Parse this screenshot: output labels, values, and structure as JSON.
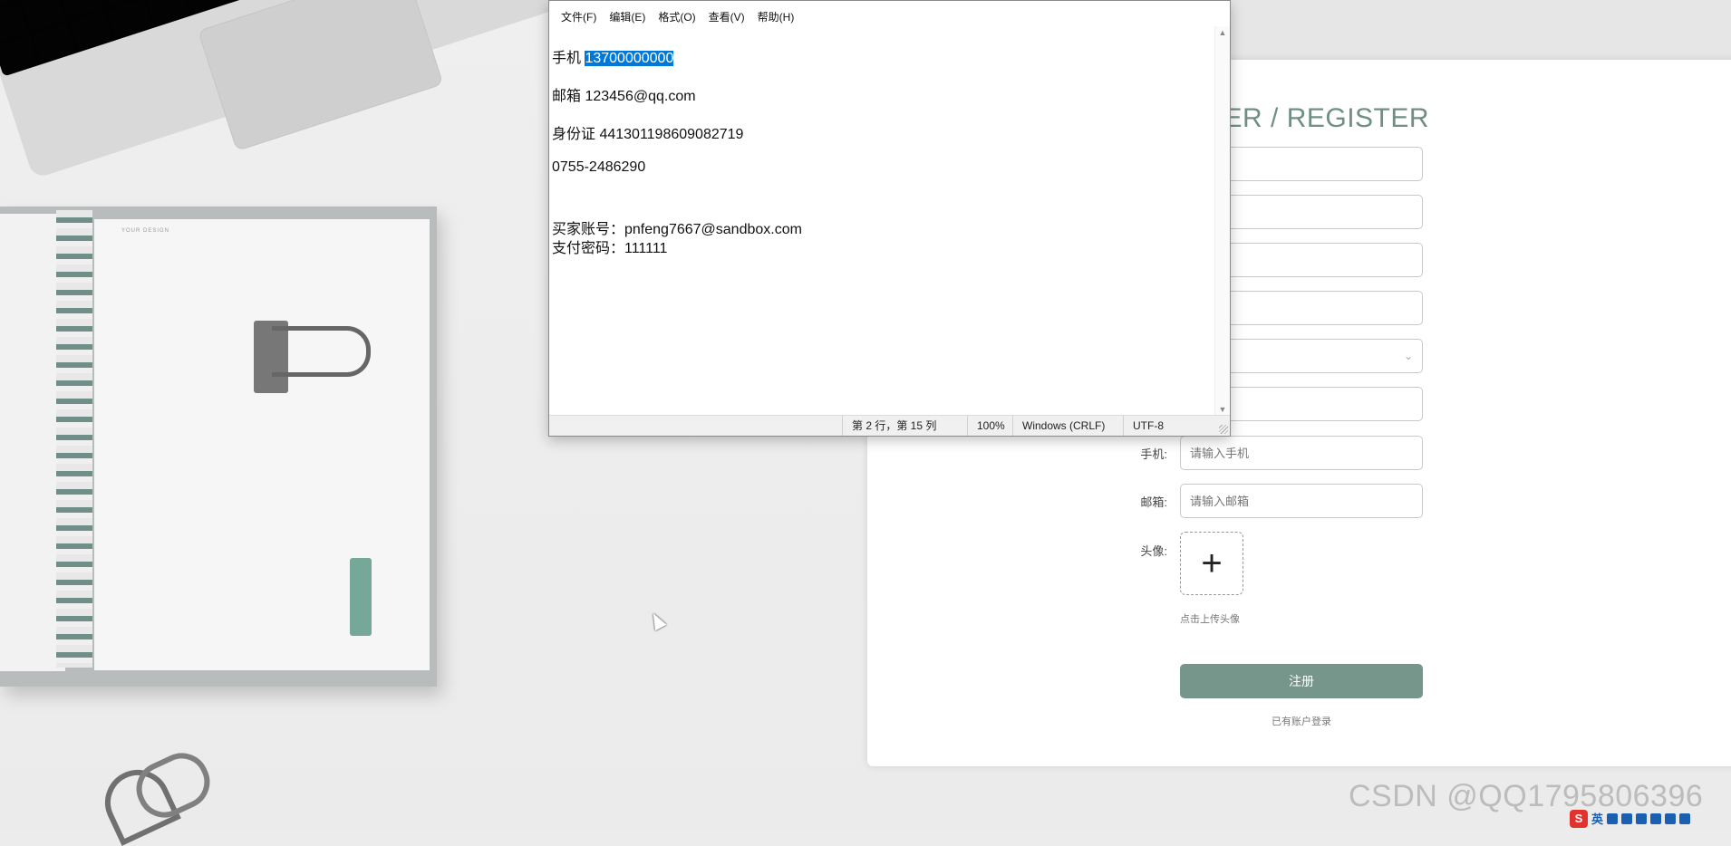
{
  "register": {
    "title": "SER / REGISTER",
    "fields": [
      {
        "label": "",
        "placeholder": ""
      },
      {
        "label": "",
        "placeholder": ""
      },
      {
        "label": "",
        "placeholder": ""
      },
      {
        "label": "",
        "placeholder": ""
      },
      {
        "label": "",
        "placeholder": "",
        "type": "select"
      },
      {
        "label": "",
        "placeholder": ""
      },
      {
        "label": "手机:",
        "placeholder": "请输入手机"
      },
      {
        "label": "邮箱:",
        "placeholder": "请输入邮箱"
      }
    ],
    "avatar_label": "头像:",
    "avatar_plus": "+",
    "upload_hint": "点击上传头像",
    "submit_label": "注册",
    "login_link": "已有账户登录"
  },
  "notepad": {
    "menu": [
      "文件(F)",
      "编辑(E)",
      "格式(O)",
      "查看(V)",
      "帮助(H)"
    ],
    "lines": {
      "phone_prefix": "手机 ",
      "phone_selected": "13700000000",
      "email": "邮箱 123456@qq.com",
      "id_card": "身份证 441301198609082719",
      "tel": "0755-2486290",
      "buyer": "买家账号：pnfeng7667@sandbox.com",
      "pay_password": "支付密码：111111"
    },
    "status": {
      "position": "第 2 行，第 15 列",
      "zoom": "100%",
      "line_ending": "Windows (CRLF)",
      "encoding": "UTF-8"
    }
  },
  "background": {
    "notebook_label": "YOUR DESIGN"
  },
  "watermark": "CSDN @QQ1795806396",
  "tray": {
    "ime_logo": "S",
    "ime_mode": "英"
  },
  "colors": {
    "accent": "#76958b",
    "selection": "#0078d7",
    "title": "#6f8f86"
  }
}
